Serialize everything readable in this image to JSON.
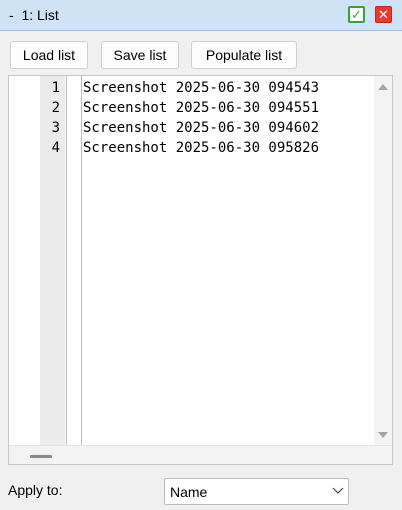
{
  "window": {
    "title": "-  1: List",
    "accept_icon": "checkmark-icon",
    "close_icon": "close-icon",
    "accent_colors": {
      "accept": "#35a334",
      "close": "#e53b2d",
      "titlebar": "#cfe3f6"
    }
  },
  "toolbar": {
    "load_label": "Load list",
    "save_label": "Save list",
    "populate_label": "Populate list"
  },
  "editor": {
    "lines": [
      {
        "number": "1",
        "text": "Screenshot 2025-06-30 094543"
      },
      {
        "number": "2",
        "text": "Screenshot 2025-06-30 094551"
      },
      {
        "number": "3",
        "text": "Screenshot 2025-06-30 094602"
      },
      {
        "number": "4",
        "text": "Screenshot 2025-06-30 095826"
      }
    ]
  },
  "apply": {
    "label": "Apply to:",
    "selected": "Name"
  }
}
